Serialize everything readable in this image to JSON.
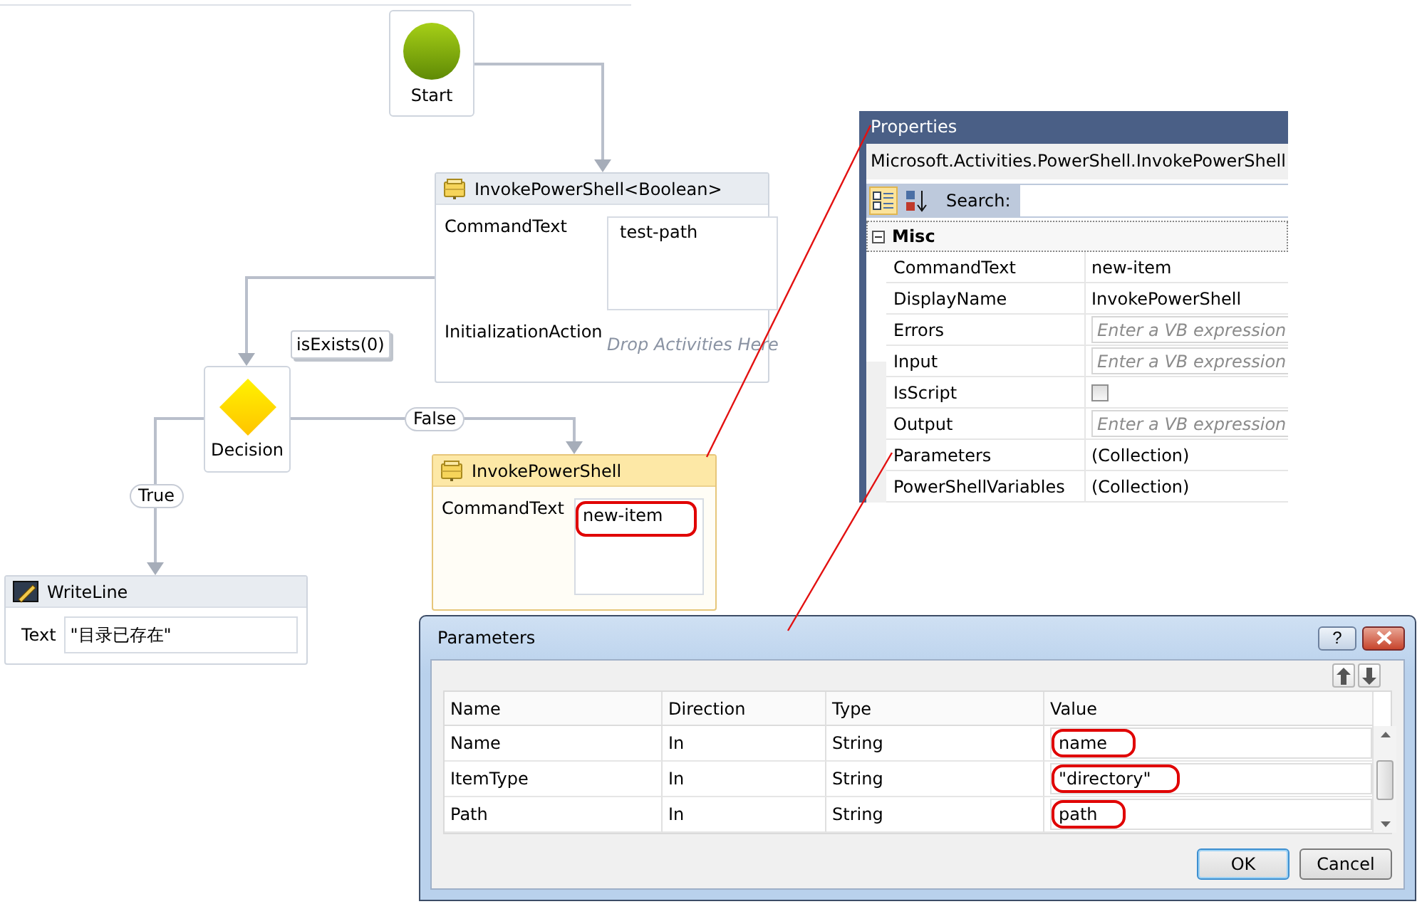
{
  "flowchart": {
    "start": {
      "label": "Start"
    },
    "invoke_boolean": {
      "title": "InvokePowerShell<Boolean>",
      "selected": false,
      "command_label": "CommandText",
      "command_value": "test-path",
      "highlighted": false,
      "init_label": "InitializationAction",
      "init_placeholder": "Drop Activities Here"
    },
    "decision": {
      "label": "Decision",
      "annotation": "isExists(0)"
    },
    "branches": [
      {
        "label": "False"
      },
      {
        "label": "True"
      }
    ],
    "invoke": {
      "title": "InvokePowerShell",
      "selected": true,
      "command_label": "CommandText",
      "command_value": "new-item",
      "highlighted": true
    },
    "writeline": {
      "title": "WriteLine",
      "selected": false,
      "field_label": "Text",
      "field_value": "\"目录已存在\""
    }
  },
  "properties": {
    "title": "Properties",
    "type_name": "Microsoft.Activities.PowerShell.InvokePowerShell",
    "view_buttons": [
      {
        "kind": "categorized",
        "selected": true
      },
      {
        "kind": "alphabetical",
        "selected": false
      }
    ],
    "search_label": "Search:",
    "category": {
      "name": "Misc",
      "expanded": true,
      "rows": [
        {
          "name": "CommandText",
          "kind": "text",
          "value": "new-item"
        },
        {
          "name": "DisplayName",
          "kind": "text",
          "value": "InvokePowerShell"
        },
        {
          "name": "Errors",
          "kind": "expression",
          "placeholder": "Enter a VB expression"
        },
        {
          "name": "Input",
          "kind": "expression",
          "placeholder": "Enter a VB expression"
        },
        {
          "name": "IsScript",
          "kind": "checkbox",
          "checked": false
        },
        {
          "name": "Output",
          "kind": "expression",
          "placeholder": "Enter a VB expression"
        },
        {
          "name": "Parameters",
          "kind": "text",
          "value": "(Collection)"
        },
        {
          "name": "PowerShellVariables",
          "kind": "text",
          "value": "(Collection)"
        }
      ]
    }
  },
  "dialog": {
    "title": "Parameters",
    "help_glyph": "?",
    "columns": [
      "Name",
      "Direction",
      "Type",
      "Value"
    ],
    "rows": [
      {
        "name": "Name",
        "direction": "In",
        "type": "String",
        "value": "name",
        "highlighted": true
      },
      {
        "name": "ItemType",
        "direction": "In",
        "type": "String",
        "value": "\"directory\"",
        "highlighted": true
      },
      {
        "name": "Path",
        "direction": "In",
        "type": "String",
        "value": "path",
        "highlighted": true
      }
    ],
    "buttons": [
      {
        "label": "OK",
        "default": true
      },
      {
        "label": "Cancel",
        "default": false
      }
    ]
  }
}
